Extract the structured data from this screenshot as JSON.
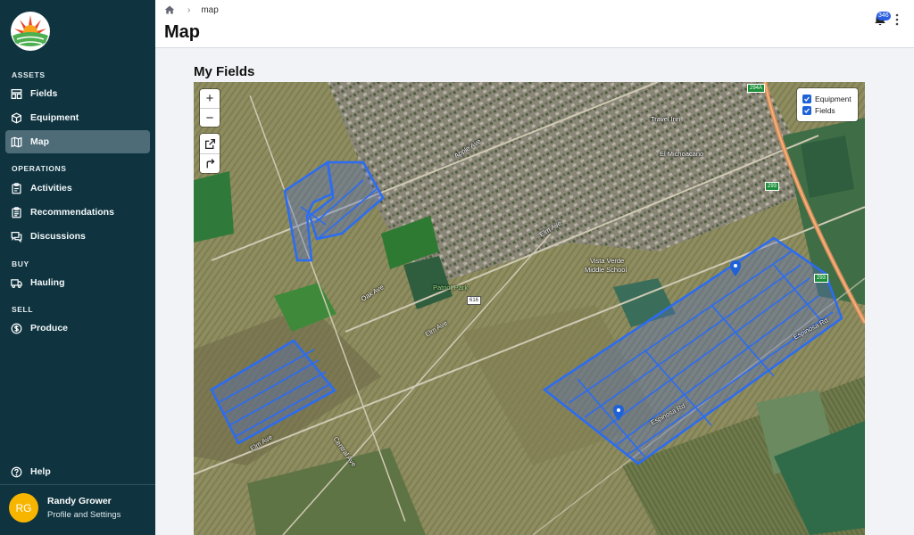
{
  "sidebar": {
    "sections": [
      {
        "title": "ASSETS",
        "items": [
          {
            "label": "Fields",
            "icon": "fields-icon",
            "active": false
          },
          {
            "label": "Equipment",
            "icon": "cube-icon",
            "active": false
          },
          {
            "label": "Map",
            "icon": "map-icon",
            "active": true
          }
        ]
      },
      {
        "title": "OPERATIONS",
        "items": [
          {
            "label": "Activities",
            "icon": "clipboard-icon",
            "active": false
          },
          {
            "label": "Recommendations",
            "icon": "clipboard-list-icon",
            "active": false
          },
          {
            "label": "Discussions",
            "icon": "chat-icon",
            "active": false
          }
        ]
      },
      {
        "title": "BUY",
        "items": [
          {
            "label": "Hauling",
            "icon": "truck-icon",
            "active": false
          }
        ]
      },
      {
        "title": "SELL",
        "items": [
          {
            "label": "Produce",
            "icon": "dollar-icon",
            "active": false
          }
        ]
      }
    ],
    "help_label": "Help",
    "user": {
      "initials": "RG",
      "name": "Randy Grower",
      "subtitle": "Profile and Settings"
    }
  },
  "header": {
    "breadcrumb": "map",
    "title": "Map",
    "notification_count": "346"
  },
  "main": {
    "title": "My Fields",
    "map": {
      "zoom_in": "+",
      "zoom_out": "−",
      "layers": [
        {
          "label": "Equipment",
          "checked": true
        },
        {
          "label": "Fields",
          "checked": true
        }
      ],
      "labels": {
        "travel_inn": "Travel Inn",
        "el_michoacano": "El Michoacano",
        "vista_verde": "Vista Verde",
        "middle_school": "Middle School",
        "patriot_park": "Patriot Park",
        "apple_ave": "Apple Ave",
        "elm_ave": "Elm Ave",
        "oak_ave": "Oak Ave",
        "central_ave": "Central Ave",
        "espinosa_rd": "Espinosa Rd",
        "espinosa_rd_2": "Espinosa Rd",
        "elm_ave_2": "Elm Ave",
        "elm_ave_3": "Elm Ave"
      },
      "shields": {
        "s294a": "294A",
        "s293a": "293",
        "s293b": "293",
        "s616": "616"
      }
    }
  },
  "colors": {
    "sidebar_bg": "#0f3440",
    "active_item": "#4e6c78",
    "field_outline": "#2a6cf5",
    "accent": "#2a5fe0"
  }
}
